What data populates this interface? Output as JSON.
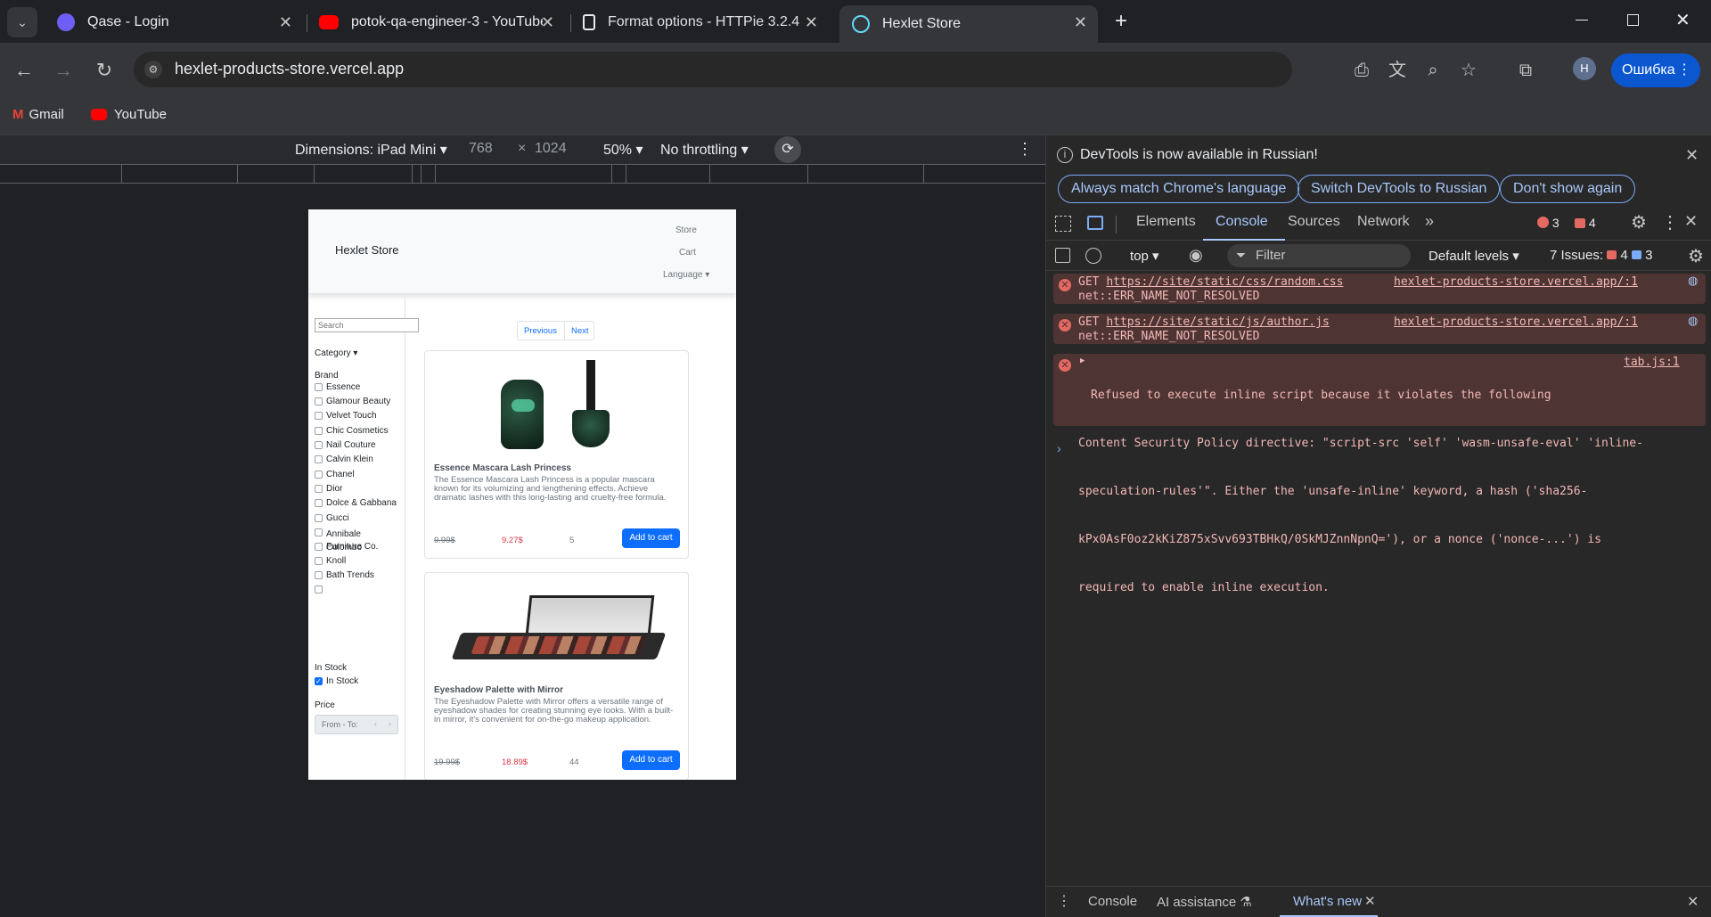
{
  "tabs": [
    {
      "title": "Qase - Login",
      "close": "✕"
    },
    {
      "title": "potok-qa-engineer-3 - YouTube",
      "close": "✕"
    },
    {
      "title": "Format options - HTTPie 3.2.4 (l",
      "close": "✕"
    },
    {
      "title": "Hexlet Store",
      "close": "✕"
    }
  ],
  "toolbar": {
    "url": "hexlet-products-store.vercel.app",
    "profile_initial": "H",
    "error_button": "Ошибка"
  },
  "bookmarks": [
    {
      "label": "Gmail"
    },
    {
      "label": "YouTube"
    }
  ],
  "device_toolbar": {
    "dimensions": "Dimensions: iPad Mini",
    "width": "768",
    "times": "×",
    "height": "1024",
    "zoom": "50%",
    "throttling": "No throttling"
  },
  "store": {
    "brand": "Hexlet Store",
    "nav": [
      "Store",
      "Cart",
      "Language"
    ],
    "search_placeholder": "Search",
    "category": "Category",
    "brand_heading": "Brand",
    "brands": [
      "Essence",
      "Glamour Beauty",
      "Velvet Touch",
      "Chic Cosmetics",
      "Nail Couture",
      "Calvin Klein",
      "Chanel",
      "Dior",
      "Dolce & Gabbana",
      "Gucci",
      "Annibale Colombo",
      "Furniture Co.",
      "Knoll",
      "Bath Trends",
      ""
    ],
    "in_stock_heading": "In Stock",
    "in_stock_label": "In Stock",
    "price_heading": "Price",
    "price_placeholder": "From - To:",
    "pagination": {
      "previous": "Previous",
      "next": "Next"
    },
    "products": [
      {
        "name": "Essence Mascara Lash Princess",
        "description": "The Essence Mascara Lash Princess is a popular mascara known for its volumizing and lengthening effects. Achieve dramatic lashes with this long-lasting and cruelty-free formula.",
        "old_price": "9.99$",
        "price": "9.27$",
        "stock": "5",
        "button": "Add to cart"
      },
      {
        "name": "Eyeshadow Palette with Mirror",
        "description": "The Eyeshadow Palette with Mirror offers a versatile range of eyeshadow shades for creating stunning eye looks. With a built-in mirror, it's convenient for on-the-go makeup application.",
        "old_price": "19.99$",
        "price": "18.89$",
        "stock": "44",
        "button": "Add to cart"
      }
    ]
  },
  "devtools": {
    "banner": "DevTools is now available in Russian!",
    "banner_buttons": [
      "Always match Chrome's language",
      "Switch DevTools to Russian",
      "Don't show again"
    ],
    "tabs": [
      "Elements",
      "Console",
      "Sources",
      "Network"
    ],
    "error_count": "3",
    "warning_count": "4",
    "context": "top",
    "filter_placeholder": "Filter",
    "levels": "Default levels",
    "issues_label": "7 Issues:",
    "issues_errors": "4",
    "issues_info": "3",
    "messages": [
      {
        "method": "GET",
        "url": "https://site/static/css/random.css",
        "error": "net::ERR_NAME_NOT_RESOLVED",
        "source": "hexlet-products-store.vercel.app/:1"
      },
      {
        "method": "GET",
        "url": "https://site/static/js/author.js",
        "error": "net::ERR_NAME_NOT_RESOLVED",
        "source": "hexlet-products-store.vercel.app/:1"
      },
      {
        "lines": [
          "Refused to execute inline script because it violates the following",
          "Content Security Policy directive: \"script-src 'self' 'wasm-unsafe-eval' 'inline-",
          "speculation-rules'\". Either the 'unsafe-inline' keyword, a hash ('sha256-",
          "kPx0AsF0oz2kKiZ875xSvv693TBHkQ/0SkMJZnnNpnQ='), or a nonce ('nonce-...') is",
          "required to enable inline execution."
        ],
        "source": "tab.js:1"
      }
    ],
    "drawer_tabs": [
      "Console",
      "AI assistance",
      "What's new"
    ]
  }
}
